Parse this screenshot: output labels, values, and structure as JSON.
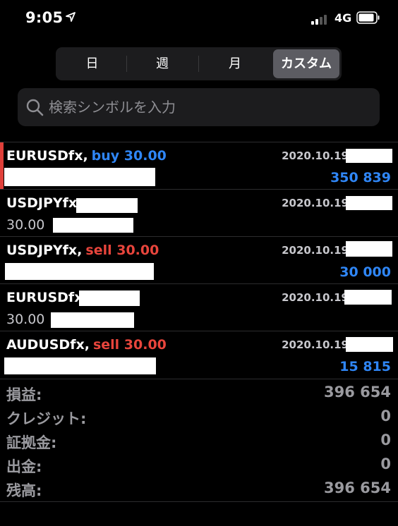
{
  "status_bar": {
    "time": "9:05",
    "network": "4G",
    "location_icon": "location-arrow-icon",
    "signal_icon": "cellular-signal-icon",
    "battery_icon": "battery-icon"
  },
  "period_tabs": [
    {
      "label": "日",
      "active": false
    },
    {
      "label": "週",
      "active": false
    },
    {
      "label": "月",
      "active": false
    },
    {
      "label": "カスタム",
      "active": true
    }
  ],
  "search": {
    "placeholder": "検索シンボルを入力",
    "value": "",
    "icon": "search-icon"
  },
  "deals": [
    {
      "symbol": "EURUSDfx,",
      "type": "buy 30.00",
      "direction": "buy",
      "date": "2020.10.19",
      "volume": "",
      "profit": "350 839",
      "selected": true
    },
    {
      "symbol": "USDJPYfx,",
      "type": "",
      "direction": "",
      "date": "2020.10.19",
      "volume": "30.00",
      "profit": "",
      "selected": false
    },
    {
      "symbol": "USDJPYfx,",
      "type": "sell 30.00",
      "direction": "sell",
      "date": "2020.10.19",
      "volume": "",
      "profit": "30 000",
      "selected": false
    },
    {
      "symbol": "EURUSDfx,",
      "type": "",
      "direction": "",
      "date": "2020.10.19",
      "volume": "30.00",
      "profit": "",
      "selected": false
    },
    {
      "symbol": "AUDUSDfx,",
      "type": "sell 30.00",
      "direction": "sell",
      "date": "2020.10.19",
      "volume": "",
      "profit": "15 815",
      "selected": false
    }
  ],
  "summary": {
    "profit_label": "損益:",
    "profit_value": "396 654",
    "credit_label": "クレジット:",
    "credit_value": "0",
    "deposit_label": "証拠金:",
    "deposit_value": "0",
    "withdrawal_label": "出金:",
    "withdrawal_value": "0",
    "balance_label": "残高:",
    "balance_value": "396 654"
  },
  "colors": {
    "background": "#000000",
    "buy": "#2f86f6",
    "sell": "#e8453c",
    "profit": "#2f86f6",
    "selected_marker": "#e0403a",
    "segment_active": "#5c5c62"
  }
}
